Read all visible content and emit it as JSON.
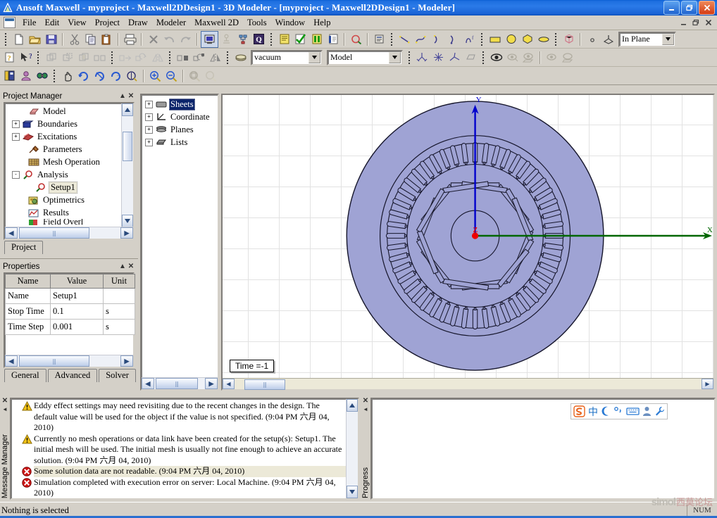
{
  "window": {
    "title": "Ansoft Maxwell - myproject - Maxwell2DDesign1 - 3D Modeler - [myproject - Maxwell2DDesign1 - Modeler]",
    "app_icon": "ansoft-logo-icon",
    "buttons": {
      "minimize": "_",
      "restore": "❐",
      "close": "✕"
    },
    "mdi_buttons": {
      "minimize": "_",
      "restore": "❐",
      "close": "✕"
    }
  },
  "menu": {
    "items": [
      {
        "label": "File",
        "accel": "F"
      },
      {
        "label": "Edit",
        "accel": "E"
      },
      {
        "label": "View",
        "accel": "V"
      },
      {
        "label": "Project",
        "accel": "P"
      },
      {
        "label": "Draw",
        "accel": "D"
      },
      {
        "label": "Modeler",
        "accel": "M"
      },
      {
        "label": "Maxwell 2D",
        "accel": "x"
      },
      {
        "label": "Tools",
        "accel": "T"
      },
      {
        "label": "Window",
        "accel": "W"
      },
      {
        "label": "Help",
        "accel": "H"
      }
    ]
  },
  "toolbars": {
    "row1": [
      {
        "name": "new-icon"
      },
      {
        "name": "open-icon"
      },
      {
        "name": "save-icon"
      },
      {
        "name": "separator"
      },
      {
        "name": "cut-icon"
      },
      {
        "name": "copy-icon"
      },
      {
        "name": "paste-icon"
      },
      {
        "name": "separator"
      },
      {
        "name": "print-icon"
      },
      {
        "name": "separator"
      },
      {
        "name": "delete-icon"
      },
      {
        "name": "undo-icon"
      },
      {
        "name": "redo-icon"
      },
      {
        "name": "separator"
      },
      {
        "name": "validate-model-icon",
        "pressed": true
      },
      {
        "name": "analyze-all-icon"
      },
      {
        "name": "analyze-setup-icon"
      },
      {
        "name": "solve-icon"
      },
      {
        "name": "gripdots"
      },
      {
        "name": "design-settings-icon"
      },
      {
        "name": "validation-check-icon"
      },
      {
        "name": "analyze-icon"
      },
      {
        "name": "report-icon"
      },
      {
        "name": "separator"
      },
      {
        "name": "field-overlays-icon"
      },
      {
        "name": "separator"
      },
      {
        "name": "properties-window-icon"
      },
      {
        "name": "gripdots"
      },
      {
        "name": "draw-line-icon"
      },
      {
        "name": "draw-spline-icon"
      },
      {
        "name": "draw-arc-center-icon"
      },
      {
        "name": "draw-arc-3point-icon"
      },
      {
        "name": "draw-equation-curve-icon"
      },
      {
        "name": "gripdots"
      },
      {
        "name": "draw-rectangle-icon"
      },
      {
        "name": "draw-circle-icon"
      },
      {
        "name": "draw-regular-polygon-icon"
      },
      {
        "name": "draw-ellipse-icon"
      },
      {
        "name": "gripdots"
      },
      {
        "name": "draw-box-icon"
      },
      {
        "name": "separator"
      },
      {
        "name": "draw-point-icon"
      },
      {
        "name": "draw-plane-icon"
      }
    ],
    "row1_combo": {
      "name": "drawing-plane-combo",
      "value": "In Plane"
    },
    "row2": [
      {
        "name": "help-context-icon"
      },
      {
        "name": "whats-this-icon"
      },
      {
        "name": "gripdots"
      },
      {
        "name": "unite-icon"
      },
      {
        "name": "subtract-icon"
      },
      {
        "name": "intersect-icon"
      },
      {
        "name": "split-icon"
      },
      {
        "name": "gripdots"
      },
      {
        "name": "move-icon"
      },
      {
        "name": "rotate-icon"
      },
      {
        "name": "mirror-icon"
      },
      {
        "name": "gripdots"
      },
      {
        "name": "duplicate-along-line-icon"
      },
      {
        "name": "duplicate-around-axis-icon"
      },
      {
        "name": "duplicate-mirror-icon"
      },
      {
        "name": "gripdots"
      },
      {
        "name": "assign-material-icon"
      }
    ],
    "material_combo": {
      "name": "material-combo",
      "value": "vacuum"
    },
    "view_combo": {
      "name": "view-mode-combo",
      "value": "Model"
    },
    "row2b": [
      {
        "name": "measure-position-icon"
      },
      {
        "name": "measure-distance-icon"
      },
      {
        "name": "measure-angle-icon"
      },
      {
        "name": "measure-area-icon"
      },
      {
        "name": "gripdots"
      },
      {
        "name": "show-all-icon"
      },
      {
        "name": "hide-selection-icon"
      },
      {
        "name": "hide-unselected-icon"
      },
      {
        "name": "separator"
      },
      {
        "name": "show-objects-icon"
      },
      {
        "name": "show-wireframe-icon"
      }
    ],
    "row3": [
      {
        "name": "edit-properties-icon"
      },
      {
        "name": "materials-icon"
      },
      {
        "name": "boundary-display-icon"
      },
      {
        "name": "gripdots"
      },
      {
        "name": "pan-icon"
      },
      {
        "name": "rotate-view-icon"
      },
      {
        "name": "dynamic-rotate-icon"
      },
      {
        "name": "spin-icon"
      },
      {
        "name": "orient-icon"
      },
      {
        "name": "separator"
      },
      {
        "name": "zoom-in-icon"
      },
      {
        "name": "zoom-out-icon"
      },
      {
        "name": "separator"
      },
      {
        "name": "fit-all-icon"
      },
      {
        "name": "fit-selection-icon"
      }
    ]
  },
  "project_manager": {
    "title": "Project Manager",
    "collapse_glyph": "▲",
    "close_glyph": "✕",
    "tree": [
      {
        "indent": 2,
        "expander": "",
        "icon": "model-icon",
        "label": "Model",
        "selected": false
      },
      {
        "indent": 1,
        "expander": "+",
        "icon": "boundaries-icon",
        "label": "Boundaries",
        "selected": false
      },
      {
        "indent": 1,
        "expander": "+",
        "icon": "excitations-icon",
        "label": "Excitations",
        "selected": false
      },
      {
        "indent": 2,
        "expander": "",
        "icon": "parameters-icon",
        "label": "Parameters",
        "selected": false
      },
      {
        "indent": 2,
        "expander": "",
        "icon": "mesh-operations-icon",
        "label": "Mesh Operation",
        "selected": false
      },
      {
        "indent": 1,
        "expander": "-",
        "icon": "analysis-icon",
        "label": "Analysis",
        "selected": false
      },
      {
        "indent": 3,
        "expander": "",
        "icon": "setup-icon",
        "label": "Setup1",
        "selected": true
      },
      {
        "indent": 2,
        "expander": "",
        "icon": "optimetrics-icon",
        "label": "Optimetrics",
        "selected": false
      },
      {
        "indent": 2,
        "expander": "",
        "icon": "results-icon",
        "label": "Results",
        "selected": false
      },
      {
        "indent": 2,
        "expander": "",
        "icon": "field-overlays-icon",
        "label": "Field Overl",
        "selected": false
      }
    ],
    "tabs": [
      {
        "label": "Project",
        "active": true
      }
    ]
  },
  "properties": {
    "title": "Properties",
    "collapse_glyph": "▲",
    "close_glyph": "✕",
    "columns": [
      "Name",
      "Value",
      "Unit"
    ],
    "rows": [
      {
        "name": "Name",
        "value": "Setup1",
        "unit": ""
      },
      {
        "name": "Stop Time",
        "value": "0.1",
        "unit": "s"
      },
      {
        "name": "Time Step",
        "value": "0.001",
        "unit": "s"
      }
    ],
    "tabs": [
      {
        "label": "General",
        "active": true
      },
      {
        "label": "Advanced",
        "active": false
      },
      {
        "label": "Solver",
        "active": false
      }
    ]
  },
  "model_tree": {
    "items": [
      {
        "expander": "+",
        "icon": "sheets-icon",
        "label": "Sheets",
        "selected": true
      },
      {
        "expander": "+",
        "icon": "coordinate-icon",
        "label": "Coordinate",
        "selected": false
      },
      {
        "expander": "+",
        "icon": "planes-icon",
        "label": "Planes",
        "selected": false
      },
      {
        "expander": "+",
        "icon": "lists-icon",
        "label": "Lists",
        "selected": false
      }
    ]
  },
  "viewport": {
    "time_label": "Time =-1",
    "axes": {
      "y_label": "Y",
      "x_label": "X",
      "z_label": "Z",
      "y_color": "#0000cc",
      "x_color": "#006600",
      "origin_color": "#ee0000"
    },
    "model": {
      "name": "motor-cross-section",
      "fill_color": "#9fa3d4",
      "edge_color": "#1a1a2e",
      "stator_slots": 48,
      "rotor_poles": 6,
      "description": "Interior permanent magnet motor 2D cross section"
    }
  },
  "message_manager": {
    "title": "Message Manager",
    "close_glyph": "✕",
    "pin_glyph": "◄",
    "messages": [
      {
        "severity": "warning",
        "text": "Eddy effect settings may need revisiting due to the recent changes in the design.  The default value will be used for the object if the value is not specified.  (9:04 PM  六月 04, 2010)",
        "highlighted": false
      },
      {
        "severity": "warning",
        "text": "Currently no mesh operations or data link have been created for the setup(s): Setup1.  The initial mesh will be used.  The initial mesh is usually not fine enough to achieve an accurate solution. (9:04 PM  六月 04, 2010)",
        "highlighted": false
      },
      {
        "severity": "error",
        "text": "Some solution data are not readable.  (9:04 PM  六月 04, 2010)",
        "highlighted": true
      },
      {
        "severity": "error",
        "text": "Simulation completed with execution error on server: Local Machine.  (9:04 PM  六月 04, 2010)",
        "highlighted": false
      }
    ]
  },
  "progress": {
    "title": "Progress",
    "close_glyph": "✕",
    "pin_glyph": "◄"
  },
  "ime_toolbar": {
    "icons": [
      {
        "name": "sogou-logo-icon",
        "glyph": "S"
      },
      {
        "name": "chinese-mode-icon",
        "glyph": "中"
      },
      {
        "name": "halfwidth-icon",
        "glyph": "☽"
      },
      {
        "name": "punctuation-icon",
        "glyph": "°,"
      },
      {
        "name": "soft-keyboard-icon",
        "glyph": "⌨"
      },
      {
        "name": "user-icon",
        "glyph": "♟"
      },
      {
        "name": "tools-icon",
        "glyph": "ὒ7"
      }
    ]
  },
  "statusbar": {
    "text": "Nothing is selected",
    "num_indicator": "NUM",
    "watermark_left": "simol",
    "watermark_right": "西莫论坛"
  }
}
